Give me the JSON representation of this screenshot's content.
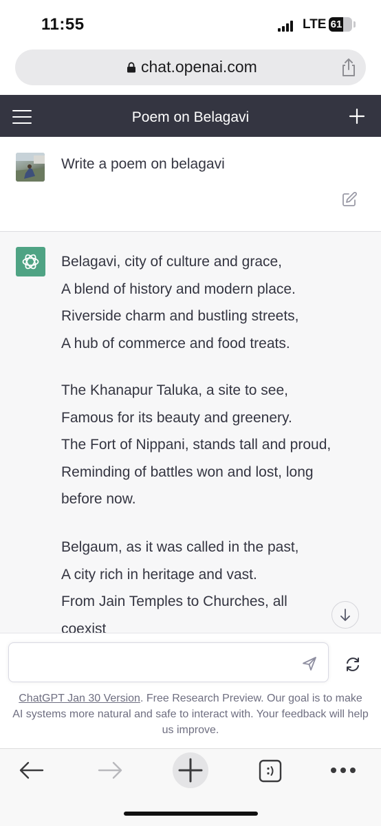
{
  "status_bar": {
    "time": "11:55",
    "network": "LTE",
    "battery": "61"
  },
  "browser": {
    "url": "chat.openai.com"
  },
  "header": {
    "title": "Poem on Belagavi"
  },
  "conversation": {
    "user_message": "Write a poem on belagavi",
    "assistant_stanzas": [
      [
        "Belagavi, city of culture and grace,",
        "A blend of history and modern place.",
        "Riverside charm and bustling streets,",
        "A hub of commerce and food treats."
      ],
      [
        "The Khanapur Taluka, a site to see,",
        "Famous for its beauty and greenery.",
        "The Fort of Nippani, stands tall and proud,",
        "Reminding of battles won and lost, long",
        "before now."
      ],
      [
        "Belgaum, as it was called in the past,",
        "A city rich in heritage and vast.",
        "From Jain Temples to Churches, all",
        "coexist"
      ]
    ]
  },
  "composer": {
    "value": "",
    "placeholder": ""
  },
  "footer": {
    "version_link": "ChatGPT Jan 30 Version",
    "note": ". Free Research Preview. Our goal is to make AI systems more natural and safe to interact with. Your feedback will help us improve."
  },
  "icons": {
    "lock": "lock-icon",
    "share": "share-icon",
    "menu": "hamburger-icon",
    "new_chat": "plus-icon",
    "edit": "edit-icon",
    "assistant_avatar": "openai-logo-icon",
    "scroll": "arrow-down-icon",
    "send": "send-icon",
    "regenerate": "refresh-icon",
    "back": "back-arrow-icon",
    "forward": "forward-arrow-icon",
    "new_tab": "plus-icon",
    "tabs": "tabs-icon",
    "more": "more-icon"
  },
  "colors": {
    "header_bg": "#343541",
    "assistant_bg": "#f7f7f8",
    "brand": "#4fa384",
    "text": "#343541",
    "muted": "#6e6e80"
  }
}
